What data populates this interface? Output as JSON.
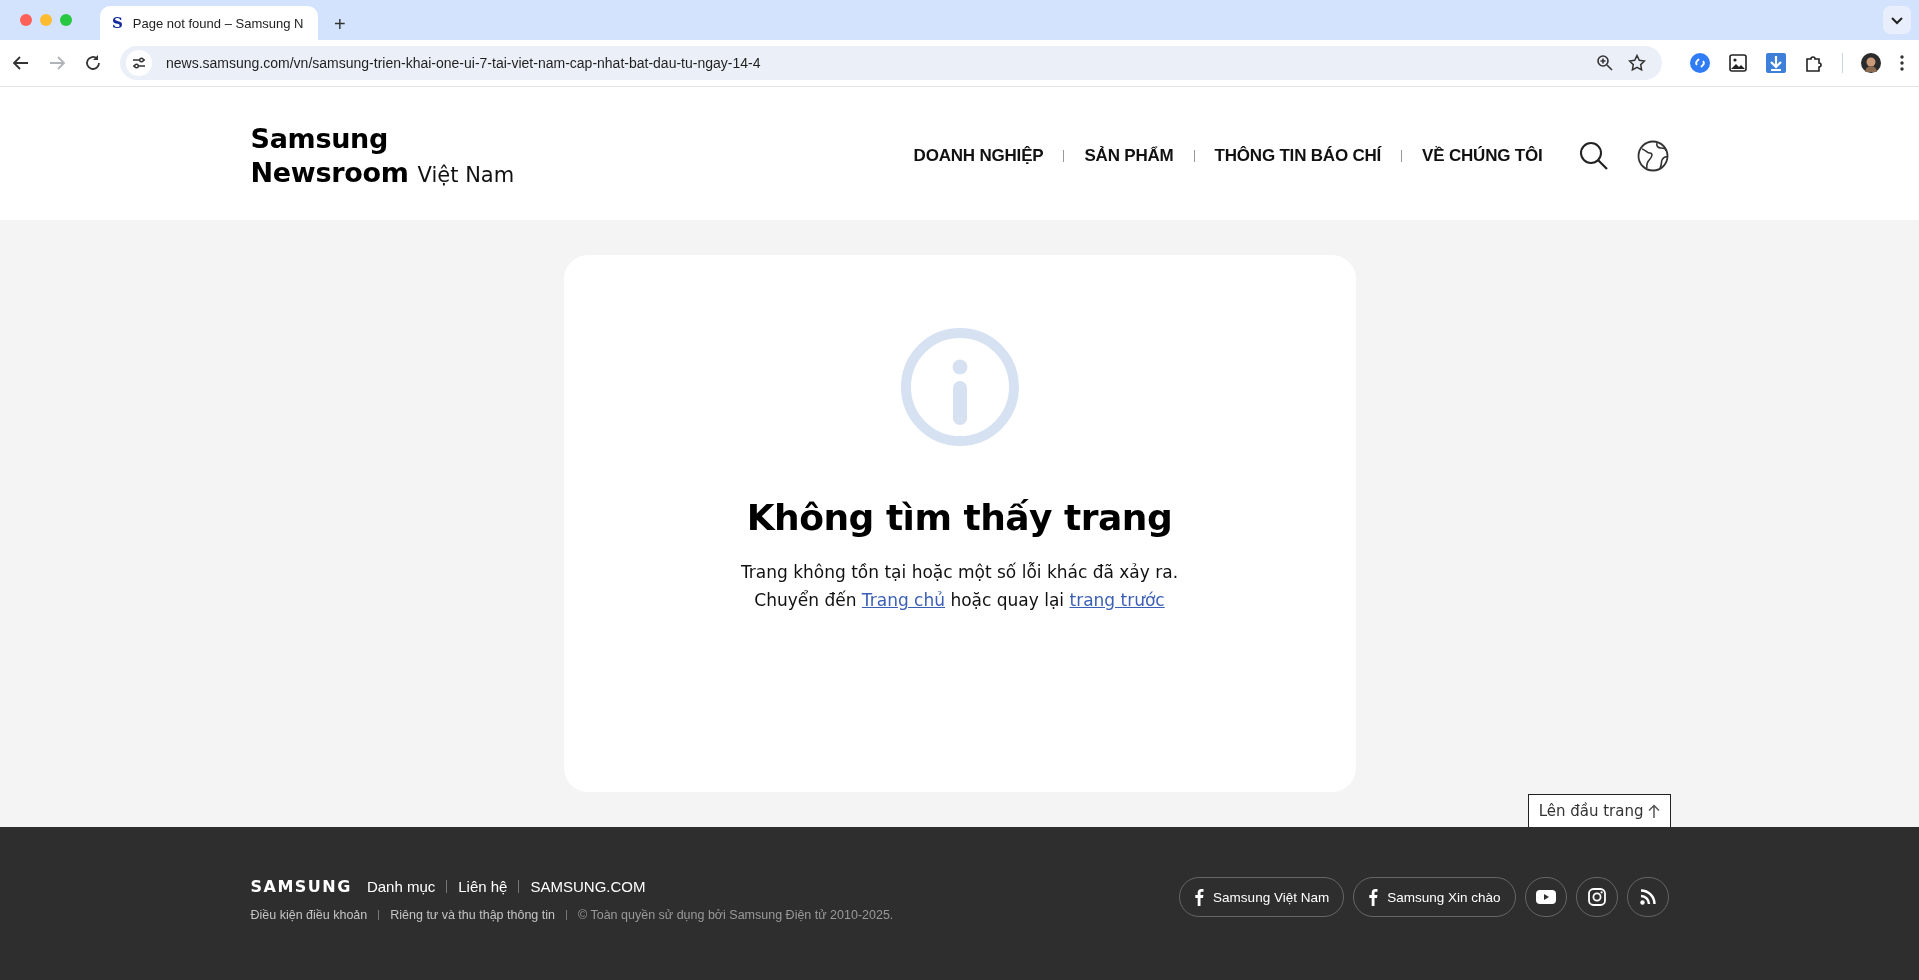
{
  "browser": {
    "tab": {
      "favicon": "S",
      "title": "Page not found – Samsung N",
      "selected": true
    },
    "new_tab": "+",
    "url": "news.samsung.com/vn/samsung-trien-khai-one-ui-7-tai-viet-nam-cap-nhat-bat-dau-tu-ngay-14-4",
    "forward_disabled": true
  },
  "header": {
    "logo": {
      "line1": "Samsung",
      "line2": "Newsroom",
      "region": "Việt Nam"
    },
    "nav": [
      "DOANH NGHIỆP",
      "SẢN PHẨM",
      "THÔNG TIN BÁO CHÍ",
      "VỀ CHÚNG TÔI"
    ]
  },
  "error": {
    "title": "Không tìm thấy trang",
    "message": "Trang không tồn tại hoặc một số lỗi khác đã xảy ra.",
    "line2": [
      {
        "kind": "text",
        "text": "Chuyển đến"
      },
      {
        "kind": "link",
        "text": "Trang chủ"
      },
      {
        "kind": "text",
        "text": "hoặc quay lại"
      },
      {
        "kind": "link",
        "text": "trang trước"
      }
    ]
  },
  "back_to_top": "Lên đầu trang",
  "footer": {
    "logo": "SAMSUNG",
    "links": [
      "Danh mục",
      "Liên hệ",
      "SAMSUNG.COM"
    ],
    "legal": [
      {
        "kind": "link",
        "text": "Điều kiện điều khoản"
      },
      {
        "kind": "link",
        "text": "Riêng tư và thu thập thông tin"
      },
      {
        "kind": "text",
        "text": "© Toàn quyền sử dụng bởi Samsung Điện tử 2010-2025."
      }
    ],
    "social": [
      {
        "kind": "facebook",
        "label": "Samsung Việt Nam"
      },
      {
        "kind": "facebook",
        "label": "Samsung Xin chào"
      },
      {
        "kind": "youtube"
      },
      {
        "kind": "instagram"
      },
      {
        "kind": "rss"
      }
    ]
  }
}
